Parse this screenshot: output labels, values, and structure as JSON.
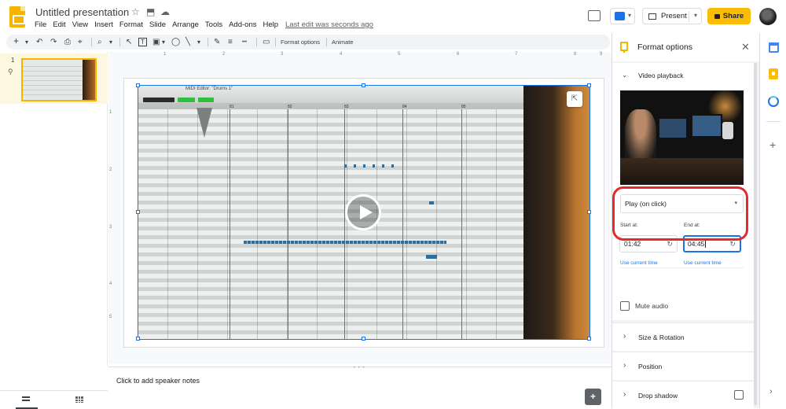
{
  "header": {
    "title": "Untitled presentation",
    "star_icon": "☆",
    "folder_icon": "⬒",
    "cloud_icon": "☁",
    "menu": [
      "File",
      "Edit",
      "View",
      "Insert",
      "Format",
      "Slide",
      "Arrange",
      "Tools",
      "Add-ons",
      "Help"
    ],
    "last_edit": "Last edit was seconds ago",
    "present_label": "Present",
    "share_label": "Share"
  },
  "toolbar": {
    "new_slide": "+",
    "dropdown": "▾",
    "undo": "↶",
    "redo": "↷",
    "print": "⎙",
    "paint_format": "⌖",
    "zoom": "⌕",
    "select": "↖",
    "textbox": "T",
    "image": "▣",
    "shape": "◯",
    "line": "╲",
    "pen": "✎",
    "border_weight": "≡",
    "border_dash": "┅",
    "comment": "▭",
    "format_options_label": "Format options",
    "animate_label": "Animate"
  },
  "filmstrip": {
    "slide_number": "1",
    "link_icon": "⚲"
  },
  "rulers": {
    "top": [
      "1",
      "2",
      "3",
      "4",
      "5",
      "6",
      "7",
      "8",
      "9"
    ],
    "left": [
      "1",
      "2",
      "3",
      "4",
      "5"
    ]
  },
  "video_overlay": {
    "midi_title": "MIDI Editor: \"Drums 1\"",
    "bar_numbers": [
      "81",
      "82",
      "83",
      "84",
      "85"
    ],
    "open_icon": "⇱"
  },
  "notes": {
    "placeholder": "Click to add speaker notes",
    "add_icon": "+"
  },
  "format_panel": {
    "title": "Format options",
    "close_icon": "✕",
    "video_playback": {
      "title": "Video playback",
      "chevron": "⌄",
      "play_mode": "Play (on click)",
      "select_arrow": "▾",
      "start_label": "Start at:",
      "start_value": "01:42",
      "end_label": "End at:",
      "end_value": "04:45",
      "reset_icon": "↻",
      "use_current_start": "Use current time",
      "use_current_end": "Use current time",
      "mute_label": "Mute audio"
    },
    "sections": [
      {
        "label": "Size & Rotation",
        "chevron": "›"
      },
      {
        "label": "Position",
        "chevron": "›"
      },
      {
        "label": "Drop shadow",
        "chevron": "›"
      }
    ]
  },
  "side_panel": {
    "add_icon": "+",
    "collapse_icon": "›"
  }
}
